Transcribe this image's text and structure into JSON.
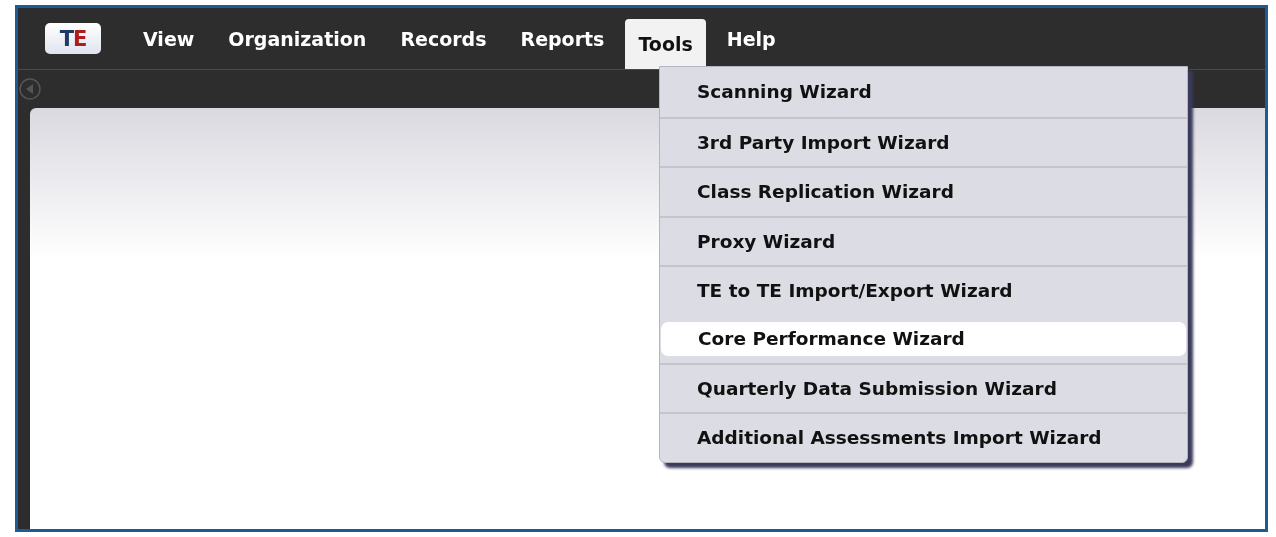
{
  "logo": {
    "text": "TE"
  },
  "menu_bar": [
    {
      "label": "View",
      "selected": false
    },
    {
      "label": "Organization",
      "selected": false
    },
    {
      "label": "Records",
      "selected": false
    },
    {
      "label": "Reports",
      "selected": false
    },
    {
      "label": "Tools",
      "selected": true
    },
    {
      "label": "Help",
      "selected": false
    }
  ],
  "dropdown": {
    "items": [
      {
        "label": "Scanning Wizard",
        "selected": false
      },
      {
        "label": "3rd Party Import Wizard",
        "selected": false
      },
      {
        "label": "Class Replication Wizard",
        "selected": false
      },
      {
        "label": "Proxy Wizard",
        "selected": false
      },
      {
        "label": "TE to TE Import/Export Wizard",
        "selected": false
      },
      {
        "label": "Core Performance Wizard",
        "selected": true
      },
      {
        "label": "Quarterly Data Submission Wizard",
        "selected": false
      },
      {
        "label": "Additional Assessments Import Wizard",
        "selected": false
      }
    ]
  }
}
